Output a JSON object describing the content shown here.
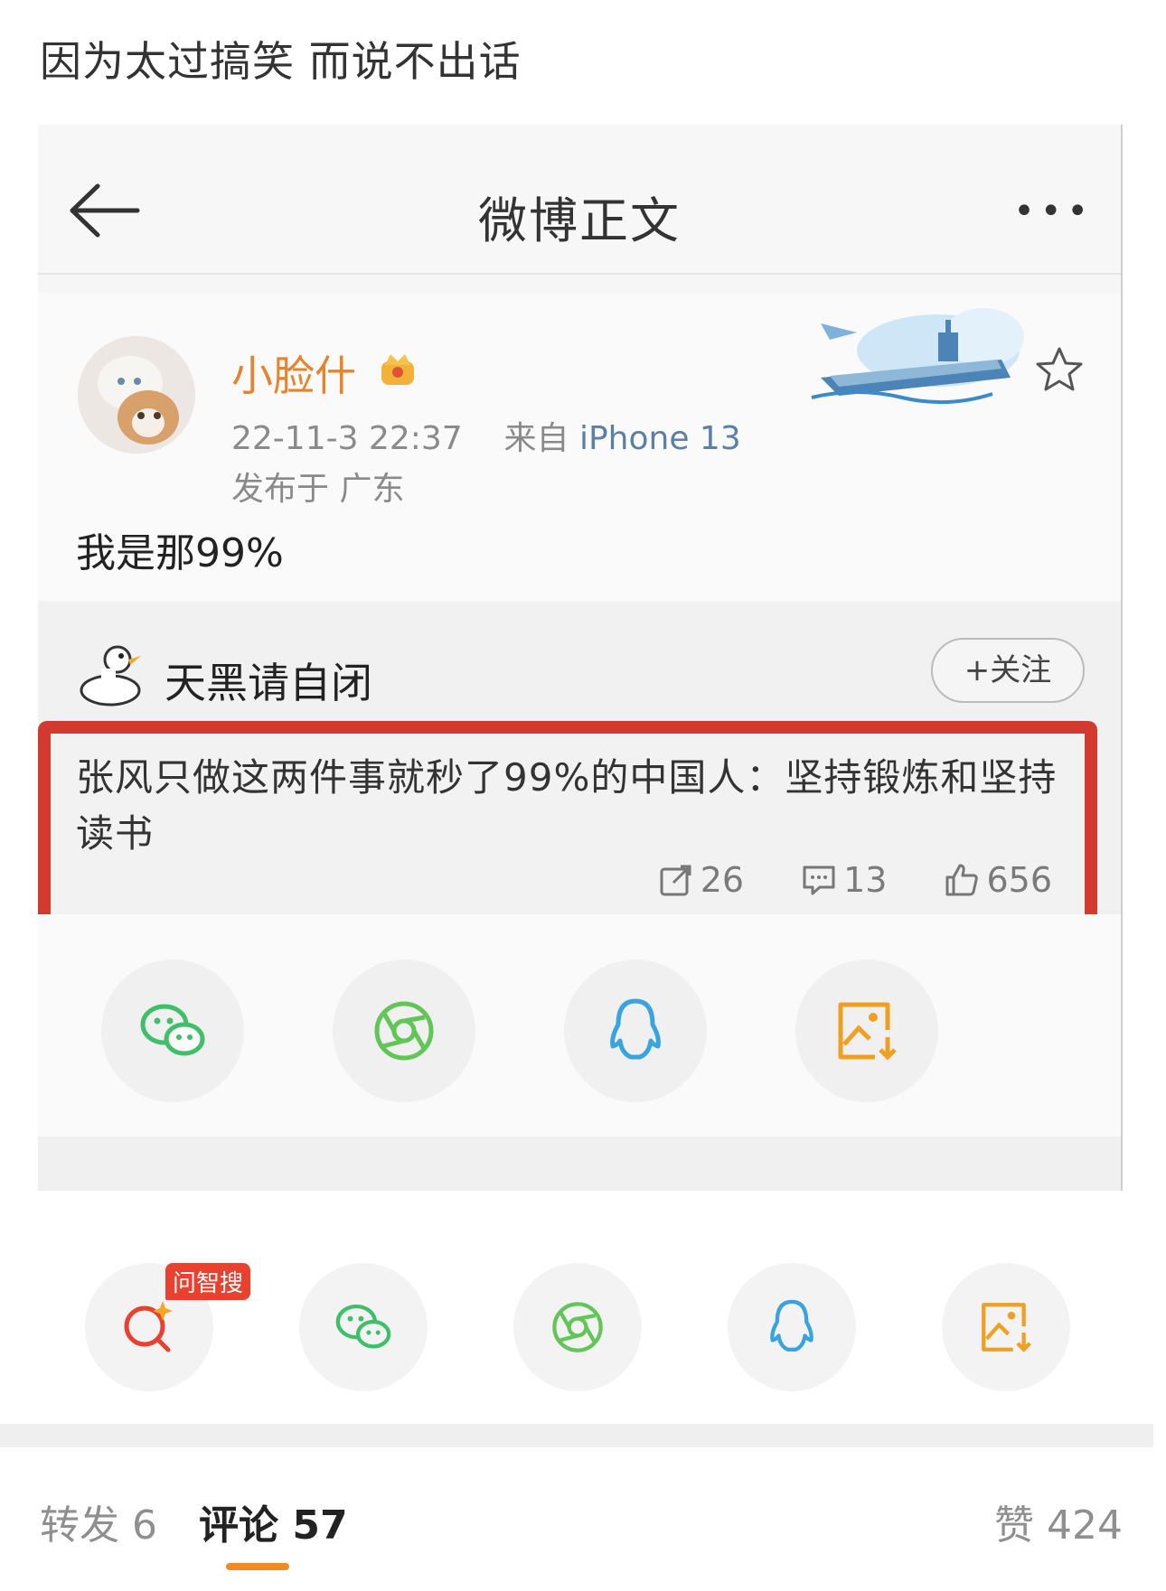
{
  "caption": "因为太过搞笑 而说不出话",
  "screenshot": {
    "nav": {
      "title": "微博正文",
      "more": "•••"
    },
    "post": {
      "username": "小脸什",
      "time": "22-11-3 22:37",
      "source_prefix": "来自",
      "device": "iPhone 13",
      "location": "发布于 广东",
      "text": "我是那99%"
    },
    "repost": {
      "author": "天黑请自闭",
      "follow_label": "+关注",
      "text": "张风只做这两件事就秒了99%的中国人：坚持锻炼和坚持读书",
      "reposts": "26",
      "comments": "13",
      "likes": "656"
    }
  },
  "share_bar": {
    "ai_badge": "问智搜"
  },
  "tabs": {
    "repost_label": "转发 6",
    "comment_label": "评论",
    "comment_count": "57",
    "like_label": "赞 424"
  },
  "colors": {
    "accent": "#f08a24",
    "highlight_border": "#d23a2f",
    "username": "#e8832b",
    "wechat": "#3fbf6a",
    "moments": "#62c557",
    "qq": "#38a3e0",
    "save": "#f0a020"
  }
}
